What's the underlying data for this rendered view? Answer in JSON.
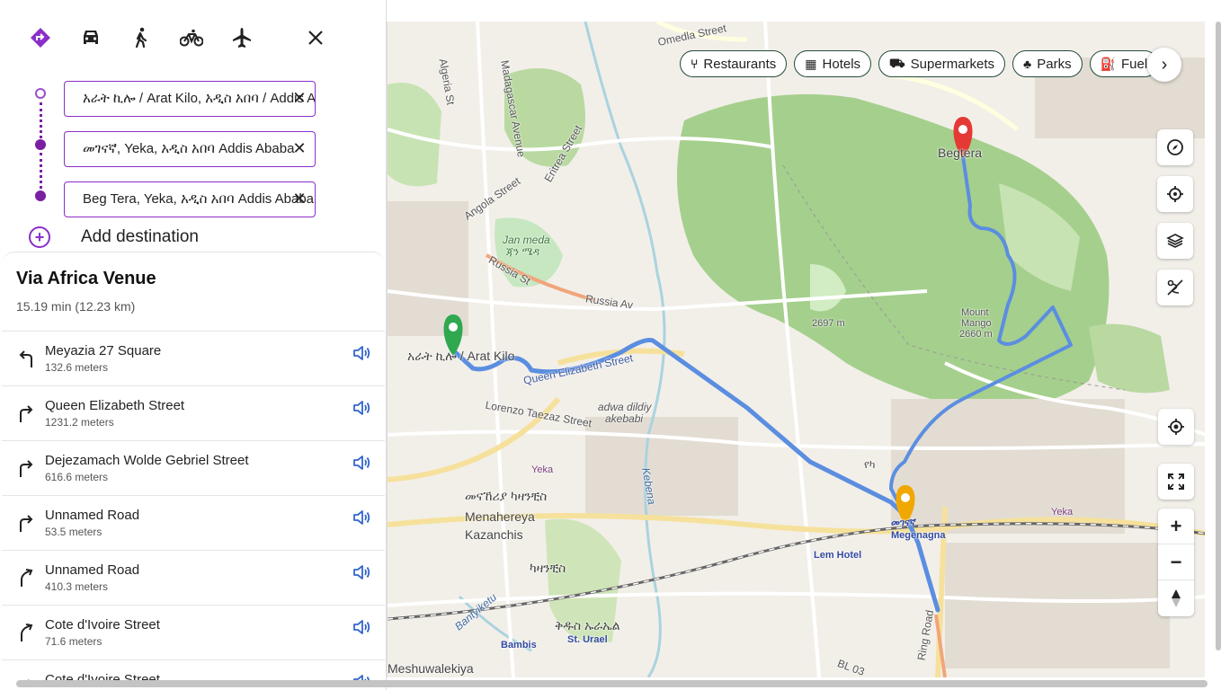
{
  "modes": [
    {
      "name": "directions-icon",
      "active": true
    },
    {
      "name": "car-icon"
    },
    {
      "name": "walk-icon"
    },
    {
      "name": "bike-icon"
    },
    {
      "name": "plane-icon"
    }
  ],
  "waypoints": [
    {
      "value": "አራት ኪሎ / Arat Kilo, አዲስ አበባ / Addis Ababa"
    },
    {
      "value": "መገናኛ, Yeka, አዲስ አበባ Addis Ababa"
    },
    {
      "value": "Beg Tera, Yeka, አዲስ አበባ Addis Ababa"
    }
  ],
  "add_destination": "Add destination",
  "route": {
    "title": "Via Africa Venue",
    "summary": "15.19 min (12.23 km)",
    "steps": [
      {
        "name": "Meyazia 27 Square",
        "dist": "132.6 meters",
        "turn": "left"
      },
      {
        "name": "Queen Elizabeth Street",
        "dist": "1231.2 meters",
        "turn": "right"
      },
      {
        "name": "Dejezamach Wolde Gebriel Street",
        "dist": "616.6 meters",
        "turn": "right"
      },
      {
        "name": "Unnamed Road",
        "dist": "53.5 meters",
        "turn": "right"
      },
      {
        "name": "Unnamed Road",
        "dist": "410.3 meters",
        "turn": "slight-right"
      },
      {
        "name": "Cote d'Ivoire Street",
        "dist": "71.6 meters",
        "turn": "slight-right"
      },
      {
        "name": "Cote d'Ivoire Street",
        "dist": "",
        "turn": "right"
      }
    ]
  },
  "chips": [
    "Restaurants",
    "Hotels",
    "Supermarkets",
    "Parks",
    "Fuel"
  ],
  "map_labels": {
    "omedla": "Omedla Street",
    "algeria": "Algeria St",
    "madagascar": "Madagascar Avenue",
    "eritrea": "Eritrea Street",
    "angola": "Angola Street",
    "russia": "Russia St",
    "russia_av": "Russia Av",
    "jan_meda": "Jan meda",
    "jan_meda_am": "ጃን ሜዳ",
    "beg_tera": "Begtera",
    "arat_kilo": "አራት ኪሎ / Arat Kilo",
    "queen_eliz": "Queen Elizabeth Street",
    "lorenzo": "Lorenzo Taezaz Street",
    "adwa": "adwa dildiy",
    "akebabi": "akebabi",
    "yeka": "Yeka",
    "yeka2": "የካ",
    "menahereya_am": "መናኸሪያ ካዛንቺስ",
    "menahereya": "Menahereya",
    "kazanchis": "Kazanchis",
    "kebena": "Kebena",
    "megenagna_am": "መገናኛ",
    "megenagna": "Megenagna",
    "lem_hotel": "Lem Hotel",
    "mount_mango": "Mount",
    "mount_mango2": "Mango",
    "mount_mango3": "2660 m",
    "elev": "2697 m",
    "st_urael_am": "ቅዱስ ኡራኤል",
    "st_urael": "St. Urael",
    "bambis": "Bambis",
    "meshuwalekiya": "Meshuwalekiya",
    "kaza2": "ካዛንቺስ",
    "bantyiketu": "Bantyiketu",
    "ring_road": "Ring Road",
    "bl": "BL 03",
    "yeka3": "Yeka"
  },
  "colors": {
    "accent": "#8b2fc9",
    "route": "#5b8ee0",
    "start_pin": "#2fa84f",
    "end_pin": "#e53935",
    "via_pin": "#f0a800"
  }
}
